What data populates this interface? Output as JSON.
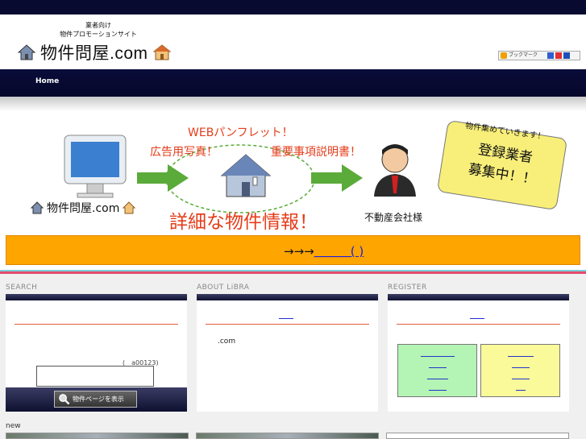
{
  "header": {
    "tagline_line1": "業者向け",
    "tagline_line2": "物件プロモーションサイト",
    "logo_text": "物件問屋.com",
    "bookmark_label": "ブックマーク"
  },
  "nav": {
    "home_label": "Home"
  },
  "hero": {
    "web_pamphlet": "WEBパンフレット！",
    "ad_photo": "広告用写真！",
    "important_doc": "重要事項説明書！",
    "detail_info": "詳細な物件情報！",
    "company": "不動産会社様",
    "logo_text": "物件問屋.com",
    "bubble_top": "物件集めていきます！",
    "bubble_line1": "登録業者",
    "bubble_line2": "募集中！！"
  },
  "banner": {
    "arrows": "→→→",
    "link_text": "＿＿＿(  )"
  },
  "columns": {
    "search_title": "SEARCH",
    "about_title": "ABOUT LiBRA",
    "register_title": "REGISTER",
    "search_hint": "(　a00123)",
    "search_placeholder": "",
    "search_button": "物件ページを表示",
    "about_link": "______",
    "about_text": ".com",
    "register_link": "______"
  },
  "new_label": "new",
  "colors": {
    "navy": "#080a30",
    "banner": "#ffa500",
    "accent_red": "#e53c1a",
    "bubble": "#f8ef7a",
    "reg_green": "#b4f4b4",
    "reg_yellow": "#fafa9a"
  }
}
